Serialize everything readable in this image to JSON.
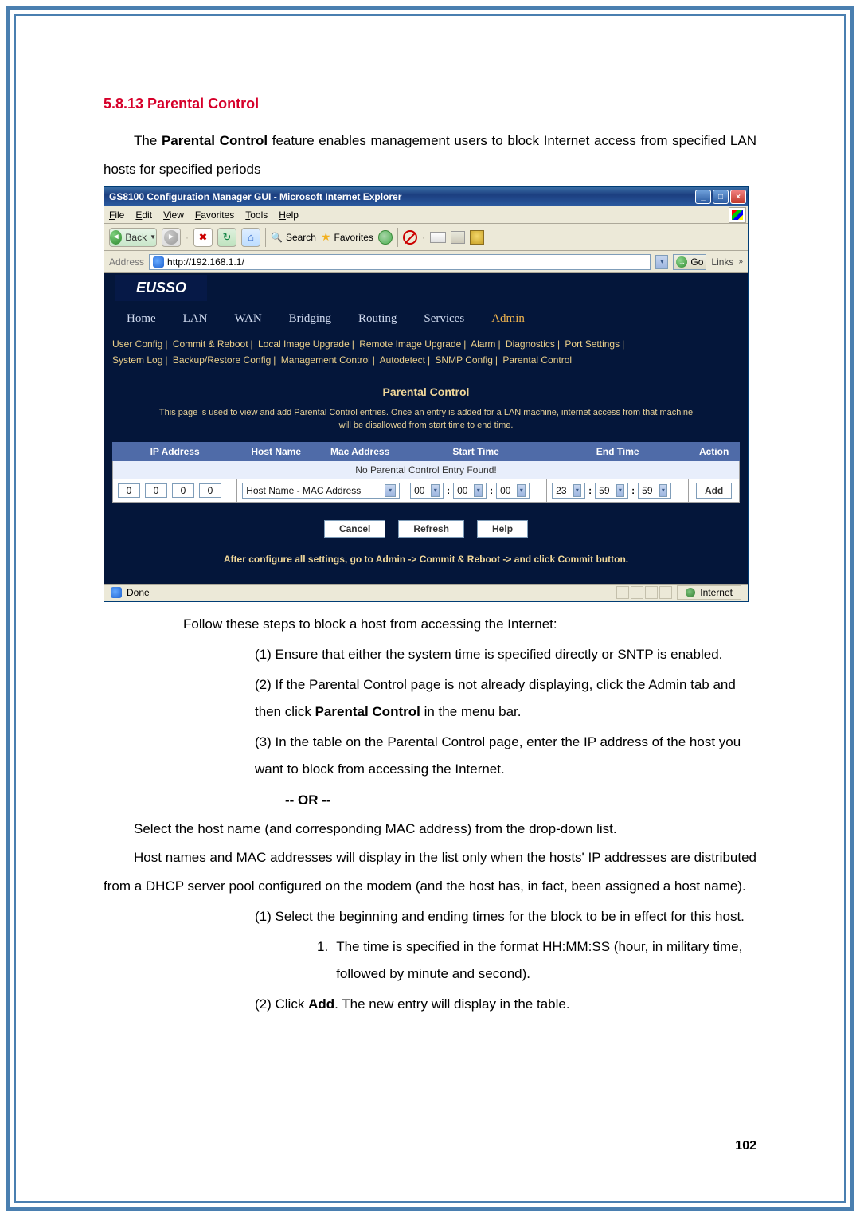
{
  "doc": {
    "section_heading": "5.8.13   Parental Control",
    "intro_prefix": "The ",
    "intro_bold": "Parental Control",
    "intro_suffix": " feature enables management users to block Internet access from specified LAN hosts for specified periods",
    "follow_steps": "Follow these steps to block a host from accessing the Internet:",
    "step1": "(1)  Ensure that either the system time is specified directly or SNTP is enabled.",
    "step2_a": "(2)  If the Parental Control page is not already displaying, click the Admin tab and then click ",
    "step2_bold": "Parental Control",
    "step2_b": " in the menu bar.",
    "step3": "(3)  In the table on the Parental Control page, enter the IP address of the host you want to block from accessing the Internet.",
    "or_sep": "-- OR --",
    "select_host": "Select the host name (and corresponding MAC address) from the drop-down list.",
    "hostnames_p": "Host names and MAC addresses will display in the list only when the hosts' IP addresses are distributed from a DHCP server pool configured on the modem (and the host has, in fact, been assigned a host name).",
    "step1b": "(1)  Select the beginning and ending times for the block to be in effect for this host.",
    "sub1_num": "1.",
    "sub1": "The time is specified in the format HH:MM:SS (hour, in military time, followed by minute and second).",
    "step2b_a": "(2)  Click ",
    "step2b_bold": "Add",
    "step2b_b": ". The new entry will display in the table.",
    "page_number": "102"
  },
  "window": {
    "title": "GS8100 Configuration Manager GUI - Microsoft Internet Explorer",
    "menu": {
      "file": "File",
      "edit": "Edit",
      "view": "View",
      "favorites": "Favorites",
      "tools": "Tools",
      "help": "Help"
    },
    "toolbar": {
      "back": "Back",
      "search_label": "Search",
      "favorites_label": "Favorites"
    },
    "address": {
      "label": "Address",
      "url": "http://192.168.1.1/",
      "go": "Go",
      "links": "Links"
    },
    "status": {
      "done": "Done",
      "zone": "Internet"
    }
  },
  "app": {
    "logo": "EUSSO",
    "nav": {
      "home": "Home",
      "lan": "LAN",
      "wan": "WAN",
      "bridging": "Bridging",
      "routing": "Routing",
      "services": "Services",
      "admin": "Admin"
    },
    "subnav_row1": [
      "User Config",
      "Commit & Reboot",
      "Local Image Upgrade",
      "Remote Image Upgrade",
      "Alarm",
      "Diagnostics",
      "Port Settings"
    ],
    "subnav_row2": [
      "System Log",
      "Backup/Restore Config",
      "Management Control",
      "Autodetect",
      "SNMP Config",
      "Parental Control"
    ],
    "heading": "Parental Control",
    "desc1": "This page is used to view and add Parental Control entries. Once an entry is added for a LAN machine, internet access from that machine",
    "desc2": "will be disallowed from start time to end time.",
    "table": {
      "headers": {
        "ip": "IP Address",
        "host": "Host Name",
        "mac": "Mac Address",
        "start": "Start Time",
        "end": "End Time",
        "action": "Action"
      },
      "no_entry": "No Parental Control Entry Found!",
      "ip": [
        "0",
        "0",
        "0",
        "0"
      ],
      "host_sel": "Host Name - MAC Address",
      "start": [
        "00",
        "00",
        "00"
      ],
      "end": [
        "23",
        "59",
        "59"
      ],
      "add": "Add"
    },
    "buttons": {
      "cancel": "Cancel",
      "refresh": "Refresh",
      "help": "Help"
    },
    "commit_note": "After configure all settings, go to Admin -> Commit & Reboot -> and click Commit button."
  }
}
